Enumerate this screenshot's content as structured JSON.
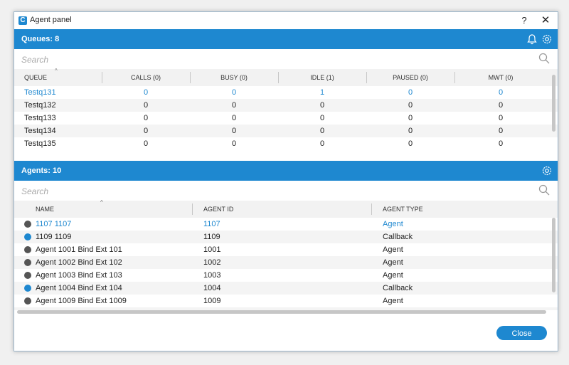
{
  "window": {
    "title": "Agent panel",
    "help": "?",
    "close": "✕",
    "app_icon": "app-logo-icon"
  },
  "queues": {
    "header": "Queues: 8",
    "search_placeholder": "Search",
    "columns": [
      "QUEUE",
      "CALLS (0)",
      "BUSY (0)",
      "IDLE (1)",
      "PAUSED (0)",
      "MWT (0)"
    ],
    "rows": [
      [
        "Testq131",
        "0",
        "0",
        "1",
        "0",
        "0"
      ],
      [
        "Testq132",
        "0",
        "0",
        "0",
        "0",
        "0"
      ],
      [
        "Testq133",
        "0",
        "0",
        "0",
        "0",
        "0"
      ],
      [
        "Testq134",
        "0",
        "0",
        "0",
        "0",
        "0"
      ],
      [
        "Testq135",
        "0",
        "0",
        "0",
        "0",
        "0"
      ]
    ]
  },
  "agents": {
    "header": "Agents: 10",
    "search_placeholder": "Search",
    "columns": [
      "NAME",
      "AGENT ID",
      "AGENT TYPE"
    ],
    "rows": [
      {
        "name": "1107 1107",
        "id": "1107",
        "type": "Agent",
        "status": "dark"
      },
      {
        "name": "1109 1109",
        "id": "1109",
        "type": "Callback",
        "status": "blue"
      },
      {
        "name": "Agent 1001 Bind Ext 101",
        "id": "1001",
        "type": "Agent",
        "status": "dark"
      },
      {
        "name": "Agent 1002 Bind Ext 102",
        "id": "1002",
        "type": "Agent",
        "status": "dark"
      },
      {
        "name": "Agent 1003 Bind Ext 103",
        "id": "1003",
        "type": "Agent",
        "status": "dark"
      },
      {
        "name": "Agent 1004 Bind Ext 104",
        "id": "1004",
        "type": "Callback",
        "status": "blue"
      },
      {
        "name": "Agent 1009 Bind Ext 1009",
        "id": "1009",
        "type": "Agent",
        "status": "dark"
      }
    ]
  },
  "footer": {
    "close_label": "Close"
  },
  "colors": {
    "accent": "#1e88d0",
    "status_dark": "#555555",
    "status_blue": "#1e88d0"
  }
}
